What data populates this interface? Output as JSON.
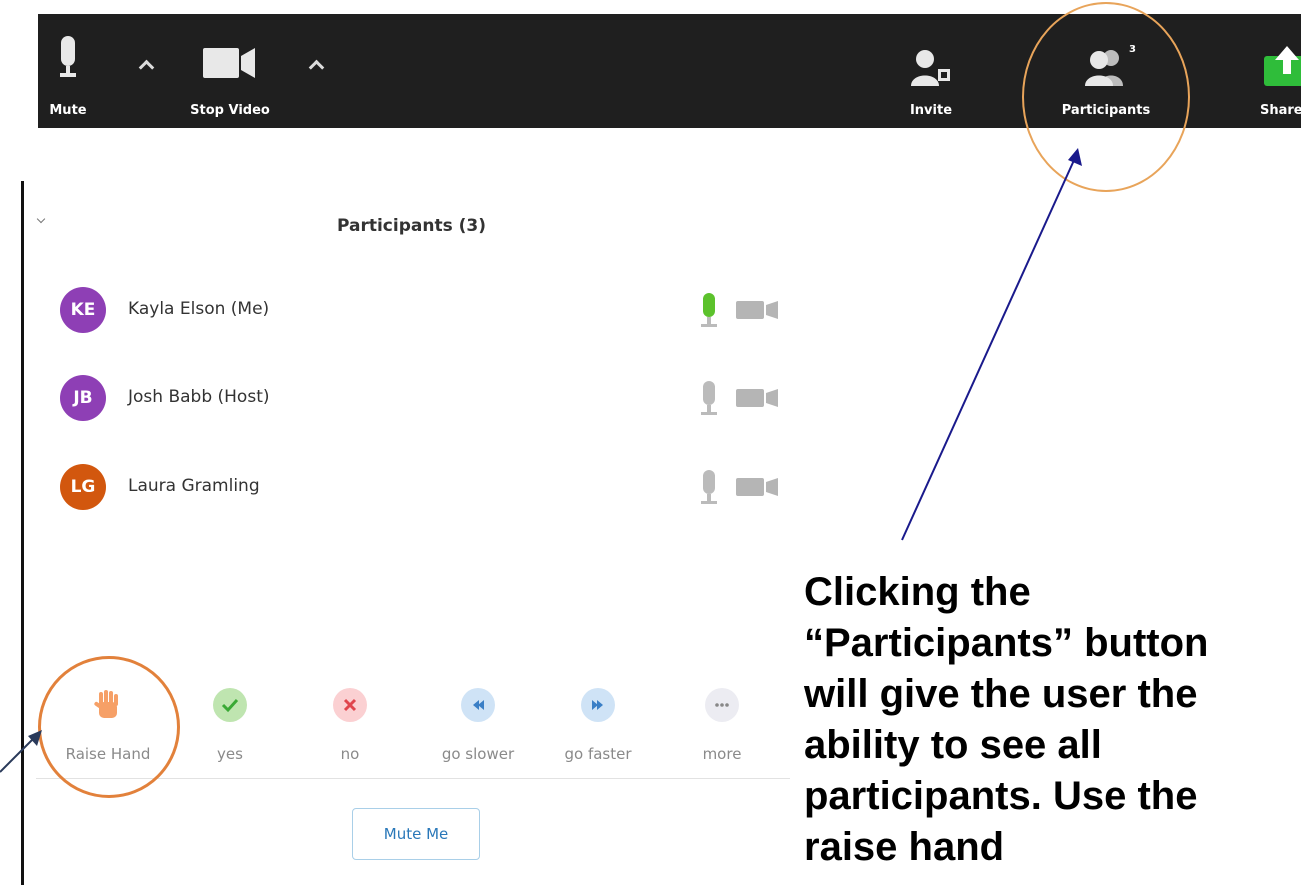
{
  "toolbar": {
    "mute_label": "Mute",
    "stop_video_label": "Stop Video",
    "invite_label": "Invite",
    "participants_label": "Participants",
    "participants_count": "3",
    "share_label": "Share"
  },
  "panel": {
    "title": "Participants (3)",
    "participants": [
      {
        "initials": "KE",
        "name": "Kayla Elson (Me)",
        "avatar_color": "#8e3fb5",
        "mic_active": true
      },
      {
        "initials": "JB",
        "name": "Josh Babb (Host)",
        "avatar_color": "#8e3fb5",
        "mic_active": false
      },
      {
        "initials": "LG",
        "name": "Laura Gramling",
        "avatar_color": "#d2570e",
        "mic_active": false
      }
    ],
    "reactions": [
      {
        "label": "Raise Hand",
        "icon": "raise-hand-icon"
      },
      {
        "label": "yes",
        "icon": "checkmark-icon"
      },
      {
        "label": "no",
        "icon": "x-icon"
      },
      {
        "label": "go slower",
        "icon": "rewind-icon"
      },
      {
        "label": "go faster",
        "icon": "fast-forward-icon"
      },
      {
        "label": "more",
        "icon": "ellipsis-icon"
      }
    ],
    "mute_me_label": "Mute Me"
  },
  "annotation": {
    "text": "Clicking the “Participants” button will give the user the ability to see all participants. Use the raise hand"
  },
  "colors": {
    "toolbar_bg": "#1f1f1f",
    "share_green": "#2fbd3a",
    "mic_active": "#5cc22c",
    "highlight_circle": "#e8a45a",
    "arrow": "#1a1a8c"
  }
}
